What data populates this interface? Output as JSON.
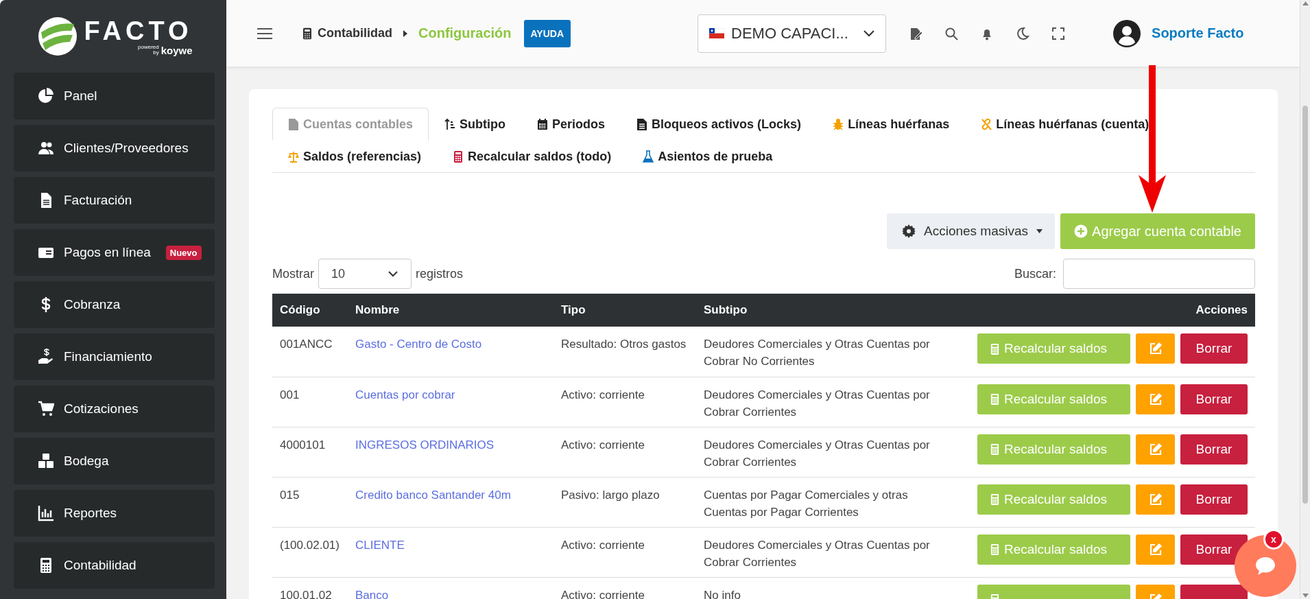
{
  "brand": {
    "name": "FACTO",
    "tagline_top": "powered",
    "tagline_by": "by",
    "tagline_brand": "koywe"
  },
  "sidebar": {
    "items": [
      {
        "label": "Panel",
        "selected": false
      },
      {
        "label": "Clientes/Proveedores",
        "selected": false
      },
      {
        "label": "Facturación",
        "selected": false
      },
      {
        "label": "Pagos en línea",
        "selected": false,
        "badge": "Nuevo"
      },
      {
        "label": "Cobranza",
        "selected": false
      },
      {
        "label": "Financiamiento",
        "selected": false
      },
      {
        "label": "Cotizaciones",
        "selected": false
      },
      {
        "label": "Bodega",
        "selected": false
      },
      {
        "label": "Reportes",
        "selected": false
      },
      {
        "label": "Contabilidad",
        "selected": false
      }
    ]
  },
  "header": {
    "breadcrumb": [
      {
        "label": "Contabilidad"
      },
      {
        "label": "Configuración"
      }
    ],
    "help_button": "AYUDA",
    "company": "DEMO CAPACI...",
    "user": "Soporte Facto"
  },
  "tabs": [
    {
      "label": "Cuentas contables",
      "selected": true
    },
    {
      "label": "Subtipo",
      "selected": false
    },
    {
      "label": "Periodos",
      "selected": false
    },
    {
      "label": "Bloqueos activos (Locks)",
      "selected": false
    },
    {
      "label": "Líneas huérfanas",
      "selected": false
    },
    {
      "label": "Líneas huérfanas (cuenta)",
      "selected": false
    },
    {
      "label": "Saldos (referencias)",
      "selected": false
    },
    {
      "label": "Recalcular saldos (todo)",
      "selected": false
    },
    {
      "label": "Asientos de prueba",
      "selected": false
    }
  ],
  "toolbar": {
    "bulk_actions": "Acciones masivas",
    "add_button": "Agregar cuenta contable"
  },
  "table_controls": {
    "show_label": "Mostrar",
    "page_size": "10",
    "records_label": "registros",
    "search_label": "Buscar:"
  },
  "table": {
    "columns": [
      "Código",
      "Nombre",
      "Tipo",
      "Subtipo",
      "Acciones"
    ],
    "rows": [
      {
        "code": "001ANCC",
        "name": "Gasto - Centro de Costo",
        "type": "Resultado: Otros gastos",
        "subtype": "Deudores Comerciales y Otras Cuentas por Cobrar No Corrientes",
        "recalc": "Recalcular saldos",
        "delete": "Borrar"
      },
      {
        "code": "001",
        "name": "Cuentas por cobrar",
        "type": "Activo: corriente",
        "subtype": "Deudores Comerciales y Otras Cuentas por Cobrar Corrientes",
        "recalc": "Recalcular saldos",
        "delete": "Borrar"
      },
      {
        "code": "4000101",
        "name": "INGRESOS ORDINARIOS",
        "type": "Activo: corriente",
        "subtype": "Deudores Comerciales y Otras Cuentas por Cobrar Corrientes",
        "recalc": "Recalcular saldos",
        "delete": "Borrar"
      },
      {
        "code": "015",
        "name": "Credito banco Santander 40m",
        "type": "Pasivo: largo plazo",
        "subtype": "Cuentas por Pagar Comerciales y otras Cuentas por Pagar Corrientes",
        "recalc": "Recalcular saldos",
        "delete": "Borrar"
      },
      {
        "code": "(100.02.01)",
        "name": "CLIENTE",
        "type": "Activo: corriente",
        "subtype": "Deudores Comerciales y Otras Cuentas por Cobrar Corrientes",
        "recalc": "Recalcular saldos",
        "delete": "Borrar"
      },
      {
        "code": "100.01.02",
        "name": "Banco",
        "type": "Activo: corriente",
        "subtype": "No info"
      }
    ]
  },
  "chat": {
    "close": "x"
  }
}
